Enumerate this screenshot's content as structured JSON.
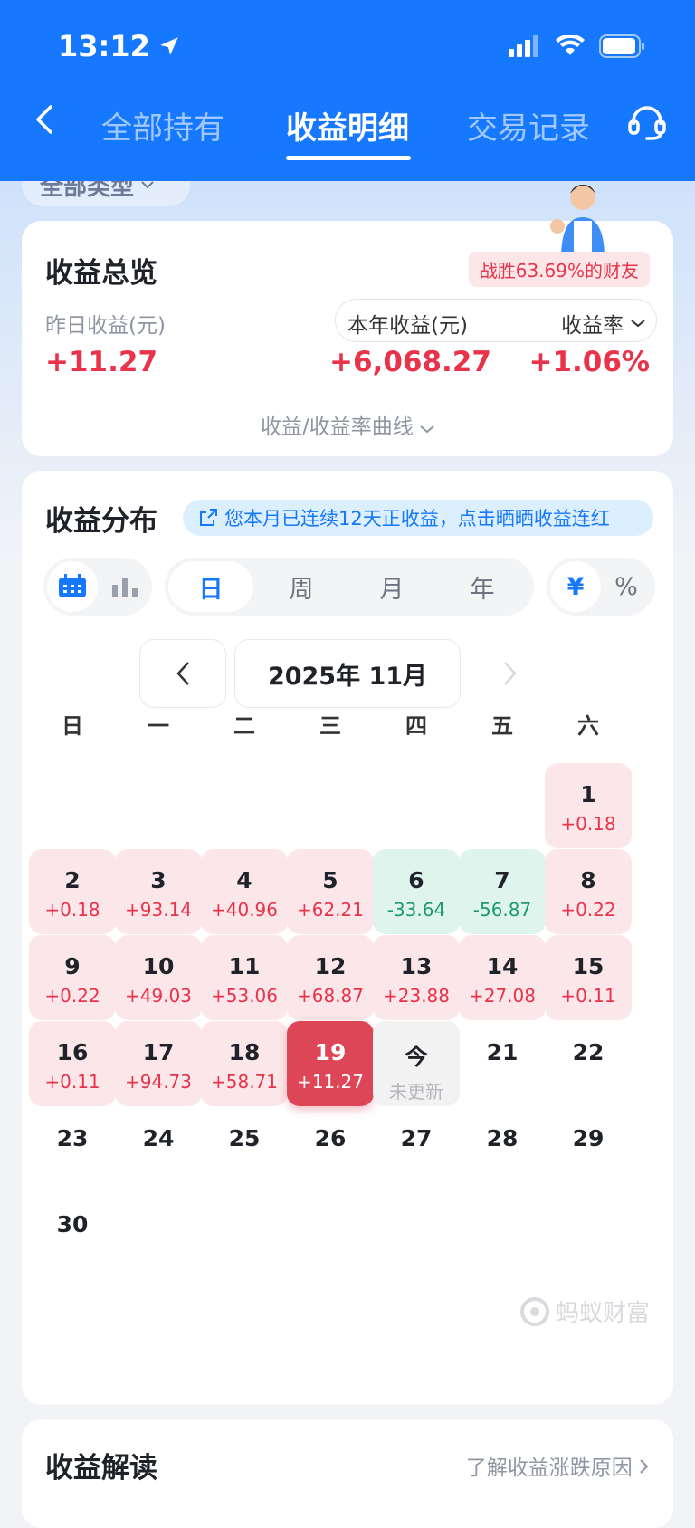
{
  "status": {
    "time": "13:12"
  },
  "nav": {
    "tabs": [
      {
        "label": "全部持有"
      },
      {
        "label": "收益明细"
      },
      {
        "label": "交易记录"
      }
    ]
  },
  "filter": {
    "label": "全部类型"
  },
  "overview": {
    "title": "收益总览",
    "badge": "战胜63.69%的财友",
    "yesterday_label": "昨日收益(元)",
    "yesterday_value": "+11.27",
    "year_label": "本年收益(元)",
    "year_value": "+6,068.27",
    "rate_label": "收益率",
    "rate_value": "+1.06%",
    "curve_label": "收益/收益率曲线"
  },
  "distribution": {
    "title": "收益分布",
    "streak_text": "您本月已连续12天正收益，点击晒晒收益连红",
    "periods": [
      {
        "label": "日"
      },
      {
        "label": "周"
      },
      {
        "label": "月"
      },
      {
        "label": "年"
      }
    ],
    "units": [
      {
        "label": "¥"
      },
      {
        "label": "%"
      }
    ],
    "month": "2025年 11月",
    "weekdays": [
      "日",
      "一",
      "二",
      "三",
      "四",
      "五",
      "六"
    ],
    "days": [
      {
        "d": "1",
        "a": "+0.18",
        "t": "up"
      },
      {
        "d": "2",
        "a": "+0.18",
        "t": "up"
      },
      {
        "d": "3",
        "a": "+93.14",
        "t": "up"
      },
      {
        "d": "4",
        "a": "+40.96",
        "t": "up"
      },
      {
        "d": "5",
        "a": "+62.21",
        "t": "up"
      },
      {
        "d": "6",
        "a": "-33.64",
        "t": "down"
      },
      {
        "d": "7",
        "a": "-56.87",
        "t": "down"
      },
      {
        "d": "8",
        "a": "+0.22",
        "t": "up"
      },
      {
        "d": "9",
        "a": "+0.22",
        "t": "up"
      },
      {
        "d": "10",
        "a": "+49.03",
        "t": "up"
      },
      {
        "d": "11",
        "a": "+53.06",
        "t": "up"
      },
      {
        "d": "12",
        "a": "+68.87",
        "t": "up"
      },
      {
        "d": "13",
        "a": "+23.88",
        "t": "up"
      },
      {
        "d": "14",
        "a": "+27.08",
        "t": "up"
      },
      {
        "d": "15",
        "a": "+0.11",
        "t": "up"
      },
      {
        "d": "16",
        "a": "+0.11",
        "t": "up"
      },
      {
        "d": "17",
        "a": "+94.73",
        "t": "up"
      },
      {
        "d": "18",
        "a": "+58.71",
        "t": "up"
      },
      {
        "d": "19",
        "a": "+11.27",
        "t": "sel"
      },
      {
        "d": "今",
        "a": "未更新",
        "t": "today"
      },
      {
        "d": "21",
        "a": "",
        "t": "none"
      },
      {
        "d": "22",
        "a": "",
        "t": "none"
      },
      {
        "d": "23",
        "a": "",
        "t": "none"
      },
      {
        "d": "24",
        "a": "",
        "t": "none"
      },
      {
        "d": "25",
        "a": "",
        "t": "none"
      },
      {
        "d": "26",
        "a": "",
        "t": "none"
      },
      {
        "d": "27",
        "a": "",
        "t": "none"
      },
      {
        "d": "28",
        "a": "",
        "t": "none"
      },
      {
        "d": "29",
        "a": "",
        "t": "none"
      },
      {
        "d": "30",
        "a": "",
        "t": "none"
      }
    ],
    "watermark": "蚂蚁财富"
  },
  "analysis": {
    "title": "收益解读",
    "link": "了解收益涨跌原因"
  },
  "colors": {
    "primary": "#1677ff",
    "gain": "#e8334a",
    "loss": "#1f9a6c"
  }
}
